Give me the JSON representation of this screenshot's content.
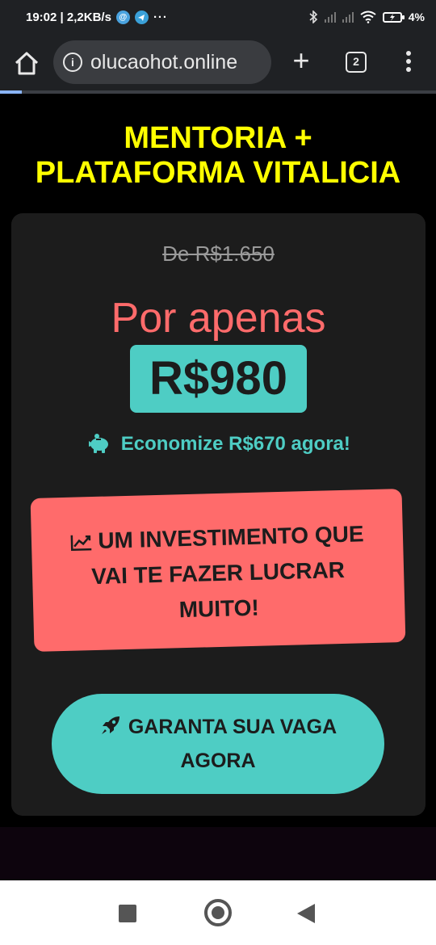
{
  "status_bar": {
    "time_speed": "19:02 | 2,2KB/s",
    "more": "···",
    "battery": "4%"
  },
  "browser": {
    "url": "olucaohot.online",
    "tab_count": "2",
    "new_tab": "+",
    "info": "i",
    "load_progress": 0.05
  },
  "page": {
    "headline_line1": "MENTORIA +",
    "headline_line2": "PLATAFORMA VITALICIA",
    "old_price": "De R$1.650",
    "por_apenas": "Por apenas",
    "price": "R$980",
    "saving": "Economize R$670 agora!",
    "invest_line1": "UM INVESTIMENTO QUE",
    "invest_line2": "VAI TE FAZER LUCRAR",
    "invest_line3": "MUITO!",
    "cta_line1": "GARANTA SUA VAGA",
    "cta_line2": "AGORA"
  },
  "colors": {
    "headline": "#ffff00",
    "accent_teal": "#4ecdc4",
    "accent_red": "#ff6b6b",
    "card_bg": "#1c1c1c"
  }
}
